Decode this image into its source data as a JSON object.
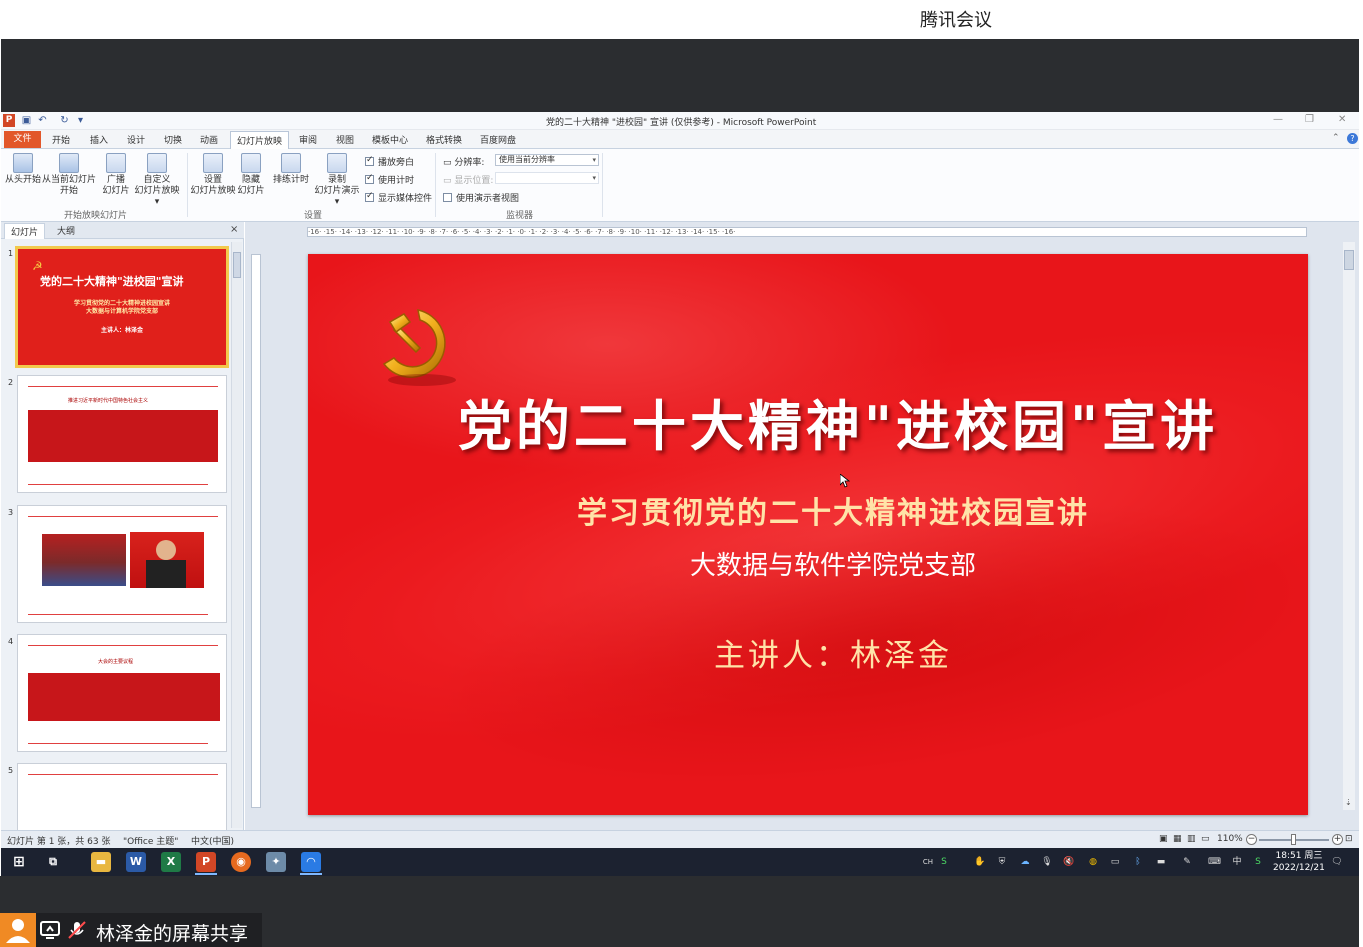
{
  "meeting": {
    "app_title": "腾讯会议",
    "share_label": "林泽金的屏幕共享"
  },
  "window": {
    "title": "党的二十大精神 \"进校园\" 宣讲 (仅供参考)  -  Microsoft PowerPoint",
    "app_badge": "P"
  },
  "menu": {
    "file": "文件",
    "tabs": [
      "开始",
      "插入",
      "设计",
      "切换",
      "动画",
      "幻灯片放映",
      "审阅",
      "视图",
      "模板中心",
      "格式转换",
      "百度网盘"
    ],
    "active_tab": "幻灯片放映"
  },
  "ribbon": {
    "from_start": "从头开始",
    "from_current_1": "从当前幻灯片",
    "from_current_2": "开始",
    "broadcast_1": "广播",
    "broadcast_2": "幻灯片",
    "custom_1": "自定义",
    "custom_2": "幻灯片放映 ▾",
    "group_start": "开始放映幻灯片",
    "setup_1": "设置",
    "setup_2": "幻灯片放映",
    "hide_1": "隐藏",
    "hide_2": "幻灯片",
    "rehearse": "排练计时",
    "record_1": "录制",
    "record_2": "幻灯片演示 ▾",
    "cb_narration": "播放旁白",
    "cb_timing": "使用计时",
    "cb_media": "显示媒体控件",
    "group_setup": "设置",
    "resolution_label": "分辨率:",
    "resolution_value": "使用当前分辨率",
    "show_on_label": "显示位置:",
    "cb_presenter": "使用演示者视图",
    "group_monitor": "监视器"
  },
  "pane": {
    "tab_slides": "幻灯片",
    "tab_outline": "大纲",
    "close": "×",
    "thumbs": [
      {
        "num": "1",
        "title": "党的二十大精神\"进校园\"宣讲",
        "sub1": "学习贯彻党的二十大精神进校园宣讲",
        "sub2": "大数据与计算机学院党支部",
        "sub3": "主讲人：林泽金"
      },
      {
        "num": "2",
        "heading": "推进习近平新时代中国特色社会主义"
      },
      {
        "num": "3"
      },
      {
        "num": "4",
        "heading": "大会的主要议程"
      },
      {
        "num": "5"
      }
    ]
  },
  "slide": {
    "title": "党的二十大精神\"进校园\"宣讲",
    "subtitle": "学习贯彻党的二十大精神进校园宣讲",
    "department": "大数据与软件学院党支部",
    "speaker": "主讲人：林泽金"
  },
  "ruler": {
    "text": "·16· ·15· ·14· ·13· ·12· ·11· ·10· ·9· ·8· ·7· ·6· ·5· ·4· ·3· ·2· ·1· ·0· ·1· ·2· ·3· ·4· ·5· ·6· ·7· ·8· ·9· ·10· ·11· ·12· ·13· ·14· ·15· ·16·"
  },
  "status": {
    "slide_count": "幻灯片 第 1 张，共 63 张",
    "theme": "\"Office 主题\"",
    "language": "中文(中国)",
    "zoom": "110%"
  },
  "taskbar": {
    "clock_time": "18:51 周三",
    "clock_date": "2022/12/21",
    "ime": "中",
    "ime_mode": "CH"
  },
  "colors": {
    "slide_red": "#e8151a",
    "gold": "#ffe3a8",
    "office_orange": "#e2572a"
  }
}
